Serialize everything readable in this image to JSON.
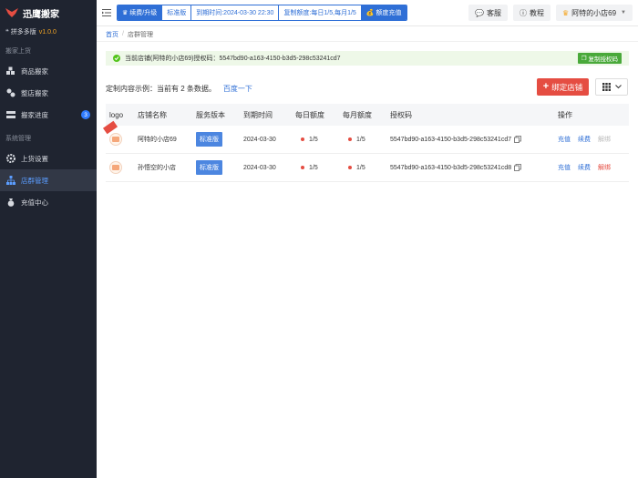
{
  "sidebar": {
    "brand": "迅鹰搬家",
    "platform": "拼多多版",
    "version": "v1.0.0",
    "section1": "搬家上货",
    "items1": [
      {
        "label": "商品搬家",
        "icon": "cubes-icon"
      },
      {
        "label": "整店搬家",
        "icon": "store-icon"
      },
      {
        "label": "搬家进度",
        "icon": "progress-icon",
        "badge": "3"
      }
    ],
    "section2": "系统管理",
    "items2": [
      {
        "label": "上货设置",
        "icon": "gear-icon"
      },
      {
        "label": "店群管理",
        "icon": "org-icon",
        "active": true
      },
      {
        "label": "充值中心",
        "icon": "money-bag-icon"
      }
    ]
  },
  "topbar": {
    "renew": "续费/升级",
    "plan": "标准版",
    "expire": "到期时间:2024-03-30 22:30",
    "quota": "复制额度:每日1/5,每月1/5",
    "recharge": "额度充值",
    "service": "客服",
    "tutorial": "教程",
    "shop": "阿特的小店69"
  },
  "breadcrumb": {
    "home": "首页",
    "current": "店群管理"
  },
  "alert": {
    "text": "当前店铺(阿特的小店69)授权码：5547bd90-a163-4150-b3d5-298c53241cd7",
    "copy_btn": "复制授权码"
  },
  "summary": {
    "text": "定制内容示例：当前有 2 条数据。",
    "link": "百度一下"
  },
  "bind_btn": "绑定店铺",
  "table": {
    "headers": {
      "logo": "logo",
      "name": "店铺名称",
      "version": "服务版本",
      "expire": "到期时间",
      "daily": "每日额度",
      "monthly": "每月额度",
      "code": "授权码",
      "ops": "操作"
    },
    "rows": [
      {
        "name": "阿特的小店69",
        "version": "标准版",
        "expire": "2024-03-30",
        "daily": "1/5",
        "monthly": "1/5",
        "code": "5547bd90-a163-4150-b3d5-298c53241cd7",
        "op1": "充值",
        "op2": "续费",
        "op3": "解绑",
        "current": true
      },
      {
        "name": "孙悟空的小店",
        "version": "标准版",
        "expire": "2024-03-30",
        "daily": "1/5",
        "monthly": "1/5",
        "code": "5547bd90-a163-4150-b3d5-298c53241cd8",
        "op1": "充值",
        "op2": "续费",
        "op3": "解绑",
        "current": false
      }
    ]
  },
  "colors": {
    "primary": "#2f6fd6",
    "danger": "#e54d42",
    "success": "#52c41a",
    "sidebar": "#1f2430"
  }
}
